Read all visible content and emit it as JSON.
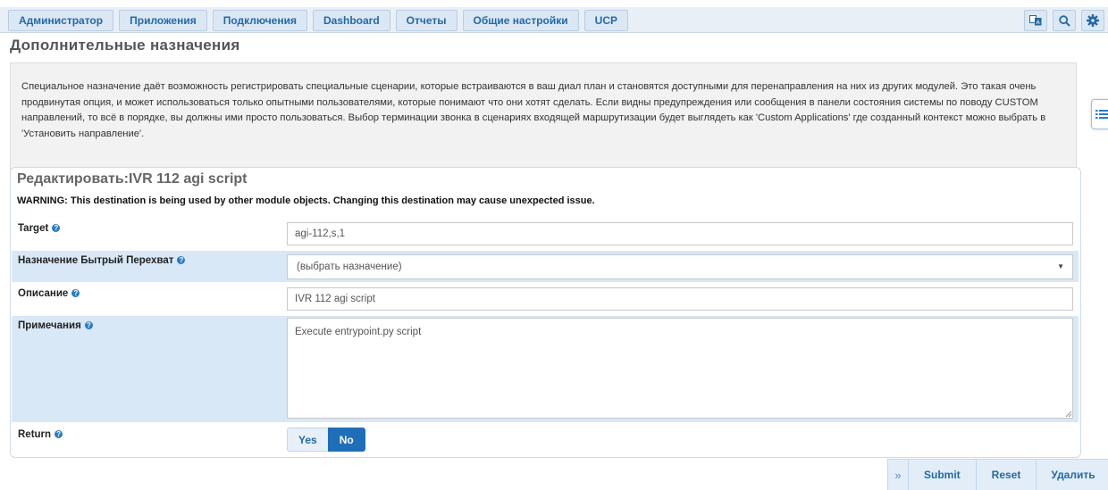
{
  "nav": {
    "tabs": [
      "Администратор",
      "Приложения",
      "Подключения",
      "Dashboard",
      "Отчеты",
      "Общие настройки",
      "UCP"
    ],
    "icons": [
      "language-icon",
      "search-icon",
      "gear-icon"
    ]
  },
  "page": {
    "title": "Дополнительные назначения"
  },
  "info": {
    "text": "Специальное назначение даёт возможность регистрировать специальные сценарии, которые встраиваются в ваш диал план и становятся доступными для перенаправления на них из других модулей. Это такая очень продвинутая опция, и может использоваться только опытными пользователями, которые понимают что они хотят сделать. Если видны предупреждения или сообщения в панели состояния системы по поводу CUSTOM направлений, то всё в порядке, вы должны ими просто пользоваться. Выбор терминации звонка в сценариях входящей маршрутизации будет выглядеть как 'Custom Applications' где созданный контекст можно выбрать в 'Установить направление'."
  },
  "edit": {
    "title": "Редактировать:IVR 112 agi script",
    "warning": "WARNING: This destination is being used by other module objects. Changing this destination may cause unexpected issue.",
    "target": {
      "label": "Target",
      "value": "agi-112,s,1"
    },
    "quick_pickup": {
      "label": "Назначение Бытрый Перехват",
      "value": "(выбрать назначение)"
    },
    "description": {
      "label": "Описание",
      "value": "IVR 112 agi script"
    },
    "notes": {
      "label": "Примечания",
      "value": "Execute entrypoint.py script"
    },
    "return": {
      "label": "Return",
      "yes": "Yes",
      "no": "No",
      "selected": "No"
    }
  },
  "actions": {
    "collapse": "»",
    "submit": "Submit",
    "reset": "Reset",
    "delete": "Удалить"
  },
  "colors": {
    "accent": "#1f6fb8",
    "link": "#2369a8",
    "highlight": "#d9e8f7"
  }
}
